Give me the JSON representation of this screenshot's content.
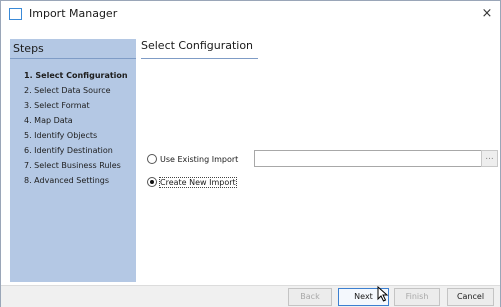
{
  "window": {
    "title": "Import Manager",
    "close_symbol": "×"
  },
  "sidebar": {
    "header": "Steps",
    "steps": [
      "1. Select Configuration",
      "2. Select Data Source",
      "3. Select Format",
      "4. Map Data",
      "5. Identify Objects",
      "6. Identify Destination",
      "7. Select Business Rules",
      "8. Advanced Settings"
    ],
    "active_step_index": 0
  },
  "main": {
    "header": "Select Configuration",
    "options": {
      "use_existing": {
        "label": "Use Existing Import",
        "selected": false
      },
      "create_new": {
        "label": "Create New Import",
        "selected": true
      }
    },
    "existing_import_value": "",
    "browse_label": "..."
  },
  "footer": {
    "back_label": "Back",
    "next_label": "Next",
    "finish_label": "Finish",
    "cancel_label": "Cancel"
  },
  "colors": {
    "sidebar_bg": "#b4c8e4",
    "accent": "#3c7fd0",
    "disabled_text": "#a8a8a8"
  }
}
